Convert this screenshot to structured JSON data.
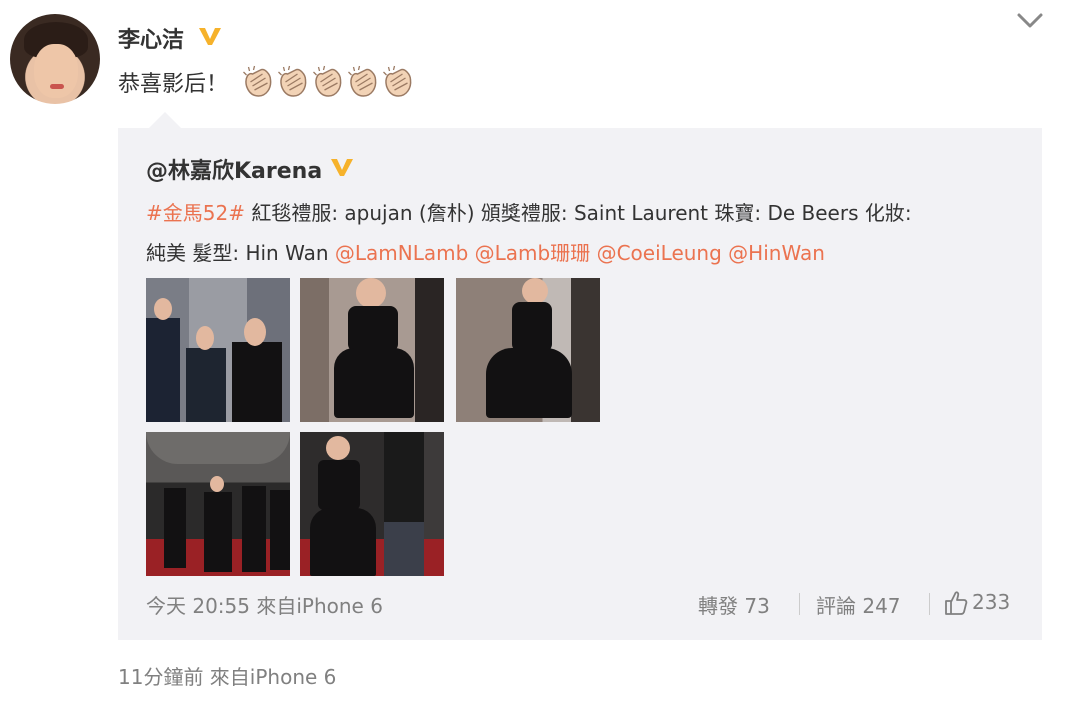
{
  "post": {
    "username": "李心洁",
    "text": "恭喜影后！",
    "clap_count": 5,
    "meta": "11分鐘前 來自iPhone 6"
  },
  "quoted": {
    "username": "@林嘉欣Karena",
    "hashtag": "#金馬52#",
    "line1_text": " 紅毯禮服: apujan (詹朴) 頒獎禮服: Saint Laurent 珠寶: De Beers 化妝:",
    "line2_text": "純美 髮型:   Hin Wan ",
    "mentions": [
      "@LamNLamb",
      "@Lamb珊珊",
      "@CoeiLeung",
      "@HinWan"
    ],
    "time": "今天 20:55 來自iPhone 6",
    "repost_label": "轉發 73",
    "comment_label": "評論 247",
    "like_count": "233"
  },
  "icons": {
    "verified": "verified-v-icon",
    "more": "chevron-down-icon",
    "like": "thumbs-up-icon",
    "emoji": "clapping-hands-icon"
  },
  "colors": {
    "link": "#eb7350",
    "verified": "#f6b22b",
    "quote_bg": "#f2f2f5",
    "meta_text": "#808080"
  }
}
